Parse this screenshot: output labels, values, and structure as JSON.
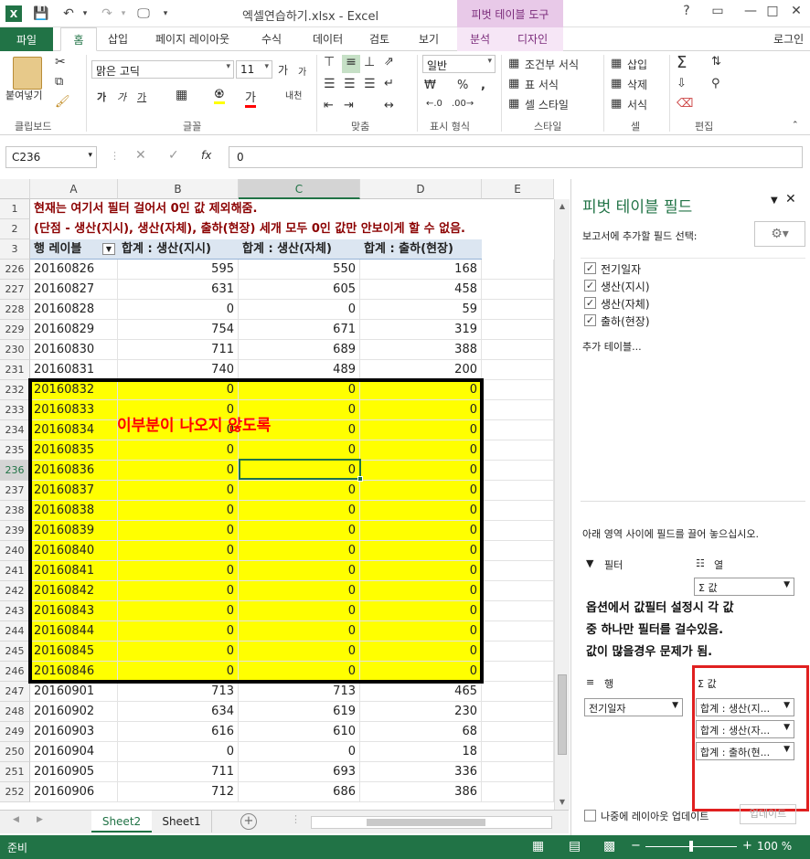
{
  "app": {
    "title": "엑셀연습하기.xlsx - Excel",
    "context_tab_group": "피벗 테이블 도구",
    "login": "로그인",
    "window_buttons": [
      "?",
      "▭",
      "—",
      "□",
      "✕"
    ]
  },
  "tabs": [
    "파일",
    "홈",
    "삽입",
    "페이지 레이아웃",
    "수식",
    "데이터",
    "검토",
    "보기",
    "분석",
    "디자인"
  ],
  "ribbon": {
    "clipboard": {
      "paste": "붙여넣기",
      "label": "클립보드"
    },
    "font": {
      "name": "맑은 고딕",
      "size": "11",
      "grow": "가",
      "shrink": "가",
      "bold": "가",
      "italic": "가",
      "underline": "가",
      "font_color": "가",
      "label": "글꼴"
    },
    "alignment": {
      "label": "맞춤"
    },
    "number": {
      "format": "일반",
      "label": "표시 형식",
      "percent": "%",
      "comma": ","
    },
    "styles": {
      "conditional": "조건부 서식",
      "table": "표 서식",
      "cell": "셀 스타일",
      "label": "스타일"
    },
    "cells": {
      "insert": "삽입",
      "delete": "삭제",
      "format": "서식",
      "label": "셀"
    },
    "editing": {
      "label": "편집"
    }
  },
  "formula_bar": {
    "name_box": "C236",
    "fx": "fx",
    "value": "0"
  },
  "columns": [
    "A",
    "B",
    "C",
    "D",
    "E"
  ],
  "header_rows": [
    {
      "num": "1",
      "text": "현재는 여기서 필터 걸어서 0인 값 제외해줌."
    },
    {
      "num": "2",
      "text": "(단점 - 생산(지시), 생산(자체), 출하(현장) 세개 모두 0인 값만 안보이게 할 수 없음."
    }
  ],
  "pivot_header": {
    "num": "3",
    "cols": [
      "행 레이블",
      "합계 : 생산(지시)",
      "합계 : 생산(자체)",
      "합계 : 출하(현장)"
    ]
  },
  "rows": [
    {
      "n": "226",
      "a": "20160826",
      "b": "595",
      "c": "550",
      "d": "168"
    },
    {
      "n": "227",
      "a": "20160827",
      "b": "631",
      "c": "605",
      "d": "458"
    },
    {
      "n": "228",
      "a": "20160828",
      "b": "0",
      "c": "0",
      "d": "59"
    },
    {
      "n": "229",
      "a": "20160829",
      "b": "754",
      "c": "671",
      "d": "319"
    },
    {
      "n": "230",
      "a": "20160830",
      "b": "711",
      "c": "689",
      "d": "388"
    },
    {
      "n": "231",
      "a": "20160831",
      "b": "740",
      "c": "489",
      "d": "200"
    },
    {
      "n": "232",
      "a": "20160832",
      "b": "0",
      "c": "0",
      "d": "0"
    },
    {
      "n": "233",
      "a": "20160833",
      "b": "0",
      "c": "0",
      "d": "0"
    },
    {
      "n": "234",
      "a": "20160834",
      "b": "0",
      "c": "0",
      "d": "0"
    },
    {
      "n": "235",
      "a": "20160835",
      "b": "0",
      "c": "0",
      "d": "0"
    },
    {
      "n": "236",
      "a": "20160836",
      "b": "0",
      "c": "0",
      "d": "0"
    },
    {
      "n": "237",
      "a": "20160837",
      "b": "0",
      "c": "0",
      "d": "0"
    },
    {
      "n": "238",
      "a": "20160838",
      "b": "0",
      "c": "0",
      "d": "0"
    },
    {
      "n": "239",
      "a": "20160839",
      "b": "0",
      "c": "0",
      "d": "0"
    },
    {
      "n": "240",
      "a": "20160840",
      "b": "0",
      "c": "0",
      "d": "0"
    },
    {
      "n": "241",
      "a": "20160841",
      "b": "0",
      "c": "0",
      "d": "0"
    },
    {
      "n": "242",
      "a": "20160842",
      "b": "0",
      "c": "0",
      "d": "0"
    },
    {
      "n": "243",
      "a": "20160843",
      "b": "0",
      "c": "0",
      "d": "0"
    },
    {
      "n": "244",
      "a": "20160844",
      "b": "0",
      "c": "0",
      "d": "0"
    },
    {
      "n": "245",
      "a": "20160845",
      "b": "0",
      "c": "0",
      "d": "0"
    },
    {
      "n": "246",
      "a": "20160846",
      "b": "0",
      "c": "0",
      "d": "0"
    },
    {
      "n": "247",
      "a": "20160901",
      "b": "713",
      "c": "713",
      "d": "465"
    },
    {
      "n": "248",
      "a": "20160902",
      "b": "634",
      "c": "619",
      "d": "230"
    },
    {
      "n": "249",
      "a": "20160903",
      "b": "616",
      "c": "610",
      "d": "68"
    },
    {
      "n": "250",
      "a": "20160904",
      "b": "0",
      "c": "0",
      "d": "18"
    },
    {
      "n": "251",
      "a": "20160905",
      "b": "711",
      "c": "693",
      "d": "336"
    },
    {
      "n": "252",
      "a": "20160906",
      "b": "712",
      "c": "686",
      "d": "386"
    }
  ],
  "selected_row": "236",
  "annotation": "이부분이 나오지 않도록",
  "sheets": {
    "tabs": [
      "Sheet2",
      "Sheet1"
    ],
    "active": "Sheet2"
  },
  "status": {
    "ready": "준비",
    "zoom": "100 %"
  },
  "pivot_pane": {
    "title": "피벗 테이블 필드",
    "choose_label": "보고서에 추가할 필드 선택:",
    "fields": [
      "전기일자",
      "생산(지시)",
      "생산(자체)",
      "출하(현장)"
    ],
    "more_tables": "추가 테이블...",
    "drag_hint": "아래 영역 사이에 필드를 끌어 놓으십시오.",
    "filter_label": "필터",
    "columns_label": "열",
    "columns_item": "Σ 값",
    "rows_label": "행",
    "rows_item": "전기일자",
    "values_label": "Σ 값",
    "values_items": [
      "합계 : 생산(지...",
      "합계 : 생산(자...",
      "합계 : 출하(현..."
    ],
    "note_lines": [
      "옵션에서 값필터 설정시 각 값",
      "중 하나만 필터를 걸수있음.",
      "값이 많을경우  문제가 됨."
    ],
    "defer": "나중에 레이아웃 업데이트",
    "update": "업데이트"
  },
  "colors": {
    "excel_green": "#217346",
    "highlight": "#ffff00",
    "dark_red": "#8b0000",
    "annotation_red": "#ff0000"
  }
}
